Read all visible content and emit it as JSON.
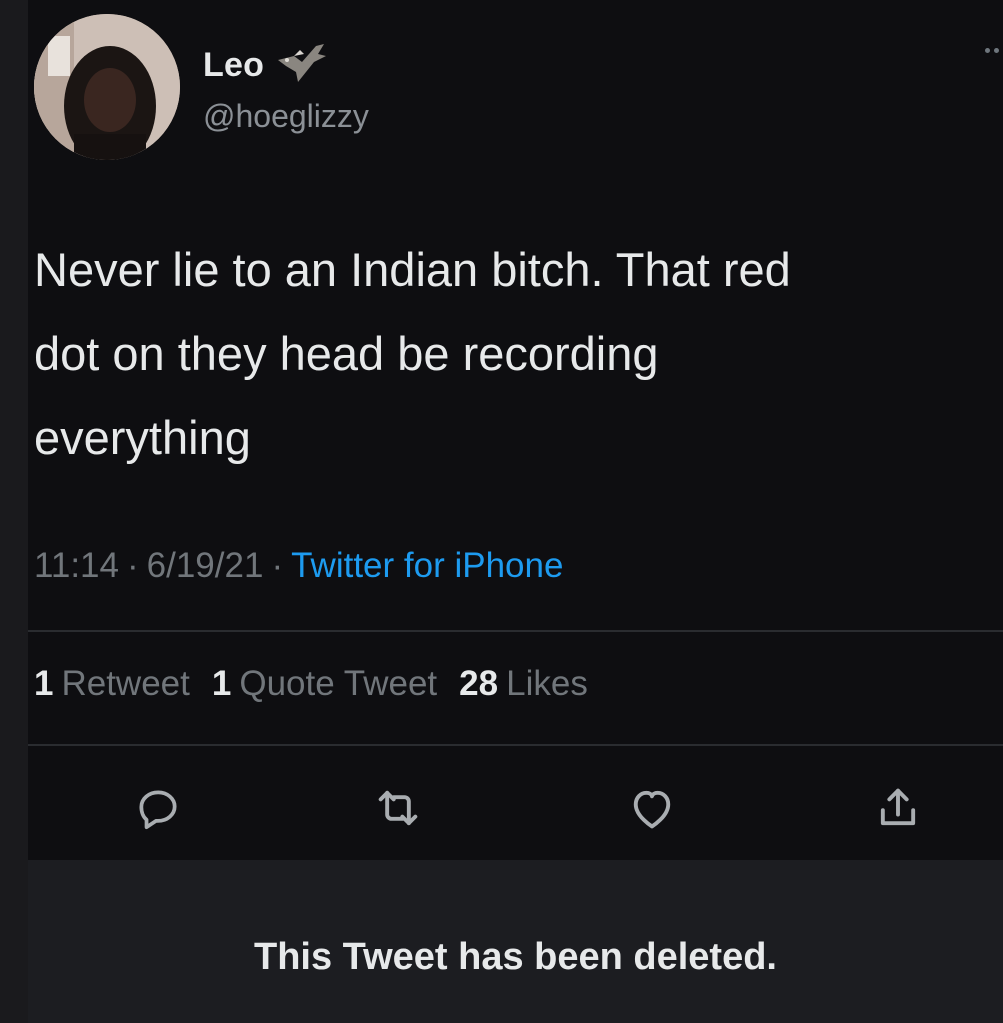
{
  "tweet": {
    "author": {
      "display_name": "Leo",
      "handle": "@hoeglizzy",
      "name_emoji_icon": "eagle-icon"
    },
    "text_lines": [
      "Never lie to an Indian bitch. That red",
      "dot on they head be recording",
      "everything"
    ],
    "meta": {
      "time": "11:14",
      "separator": "·",
      "date": "6/19/21",
      "source": "Twitter for iPhone"
    },
    "stats": {
      "retweets_count": "1",
      "retweets_label": "Retweet",
      "quotes_count": "1",
      "quotes_label": "Quote Tweet",
      "likes_count": "28",
      "likes_label": "Likes"
    },
    "actions": [
      {
        "name": "reply",
        "icon": "reply-icon"
      },
      {
        "name": "retweet",
        "icon": "retweet-icon"
      },
      {
        "name": "like",
        "icon": "heart-icon"
      },
      {
        "name": "share",
        "icon": "share-icon"
      }
    ]
  },
  "deleted_notice": "This Tweet has been deleted.",
  "colors": {
    "background": "#0e0e11",
    "text": "#e7e9ea",
    "muted": "#71767b",
    "link": "#1d9bf0",
    "banner": "#1c1d21"
  }
}
